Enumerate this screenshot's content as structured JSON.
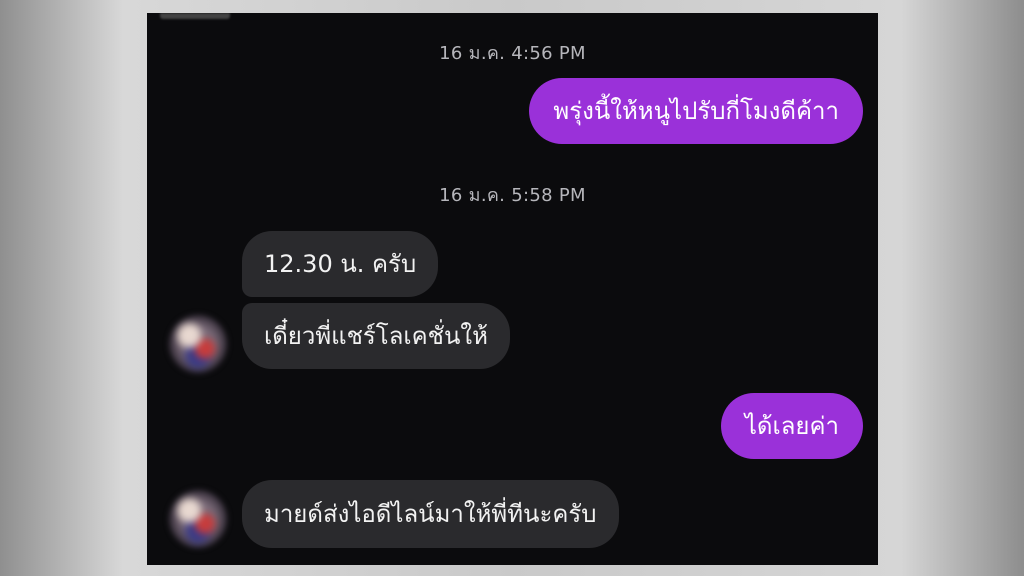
{
  "conversation": {
    "timestamps": [
      "16 ม.ค. 4:56 PM",
      "16 ม.ค. 5:58 PM"
    ],
    "messages": [
      {
        "sender": "me",
        "text": "พรุ่งนี้ให้หนูไปรับกี่โมงดีค้าา"
      },
      {
        "sender": "other",
        "text": "12.30 น. ครับ"
      },
      {
        "sender": "other",
        "text": "เดี๋ยวพี่แชร์โลเคชั่นให้"
      },
      {
        "sender": "me",
        "text": "ได้เลยค่า"
      },
      {
        "sender": "other",
        "text": "มายด์ส่งไอดีไลน์มาให้พี่ทีนะครับ"
      }
    ]
  },
  "colors": {
    "outgoing_bubble": "#9a31d9",
    "incoming_bubble": "#2a2a2d",
    "background": "#0b0b0d",
    "timestamp_text": "#b6b6bb"
  }
}
